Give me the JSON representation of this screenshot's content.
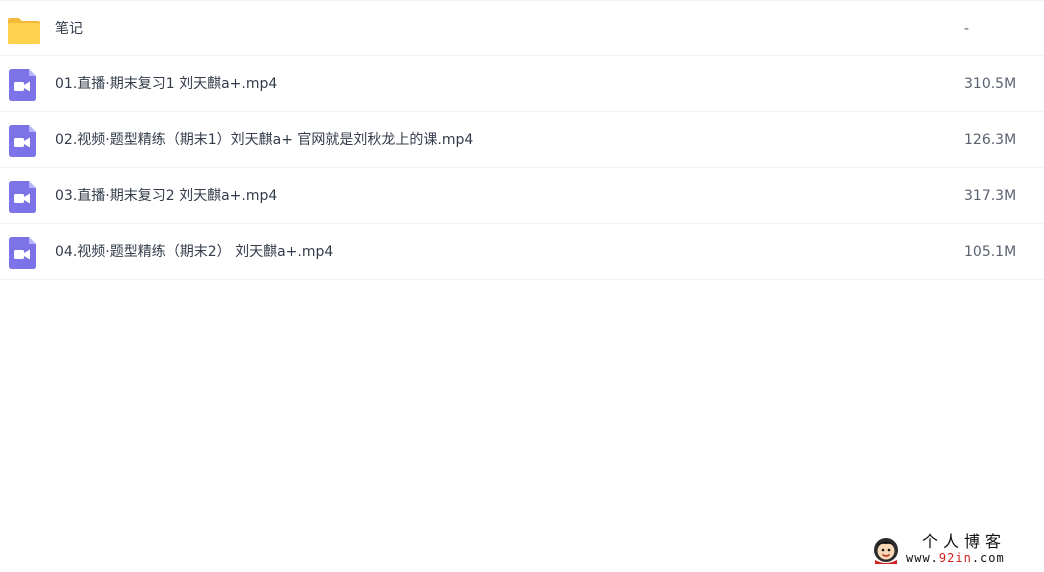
{
  "files": [
    {
      "icon": "folder-icon",
      "name": "笔记",
      "size": "-"
    },
    {
      "icon": "video-file-icon",
      "name": "01.直播·期末复习1 刘天麒a+.mp4",
      "size": "310.5M"
    },
    {
      "icon": "video-file-icon",
      "name": "02.视频·题型精练（期末1）刘天麒a+ 官网就是刘秋龙上的课.mp4",
      "size": "126.3M"
    },
    {
      "icon": "video-file-icon",
      "name": "03.直播·期末复习2 刘天麒a+.mp4",
      "size": "317.3M"
    },
    {
      "icon": "video-file-icon",
      "name": "04.视频·题型精练（期末2） 刘天麒a+.mp4",
      "size": "105.1M"
    }
  ],
  "watermark": {
    "title": "个人博客",
    "url_prefix": "www.",
    "url_accent": "92in",
    "url_suffix": ".com"
  },
  "colors": {
    "folder": "#FFD24D",
    "video_icon": "#7C74E6",
    "text": "#333B4A",
    "size_text": "#5A6170",
    "divider": "#F0F2F5",
    "watermark_accent": "#D21F1F"
  }
}
